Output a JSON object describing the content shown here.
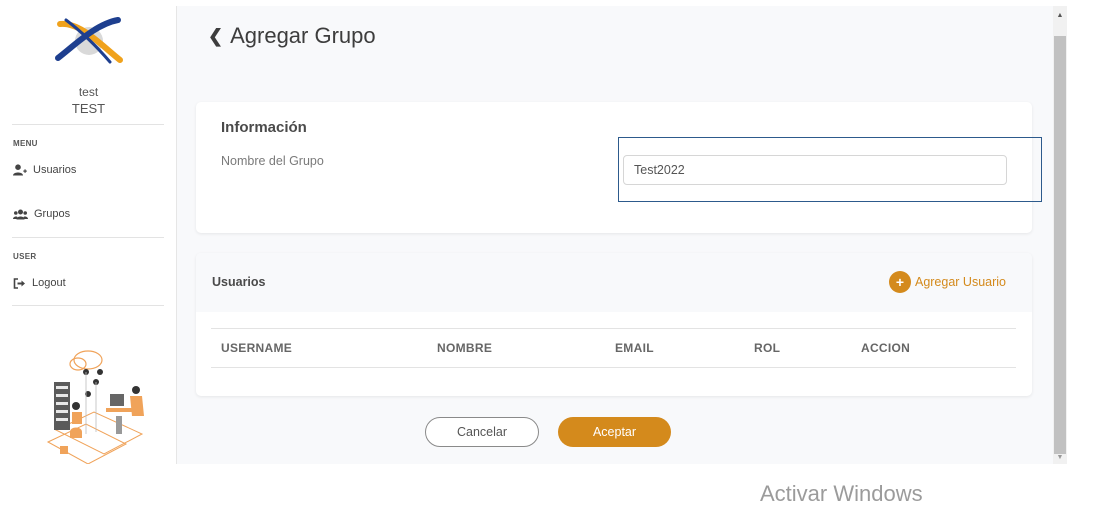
{
  "sidebar": {
    "user_name": "test",
    "user_role": "TEST",
    "menu_label": "MENU",
    "items": [
      {
        "label": "Usuarios",
        "icon": "user-plus-icon"
      },
      {
        "label": "Grupos",
        "icon": "users-group-icon"
      }
    ],
    "user_section_label": "USER",
    "logout_label": "Logout",
    "logout_icon": "sign-out-icon"
  },
  "page": {
    "title": "Agregar Grupo",
    "back_icon": "chevron-left-icon"
  },
  "info_card": {
    "title": "Información",
    "field_label": "Nombre del Grupo",
    "field_value": "Test2022"
  },
  "users_card": {
    "title": "Usuarios",
    "add_label": "Agregar Usuario",
    "columns": [
      "USERNAME",
      "NOMBRE",
      "EMAIL",
      "ROL",
      "ACCION"
    ]
  },
  "actions": {
    "cancel_label": "Cancelar",
    "accept_label": "Aceptar"
  },
  "watermark": "Activar Windows",
  "colors": {
    "accent": "#d48a1c",
    "focus_frame": "#2d5a8c",
    "logo_blue": "#1e3f8f",
    "logo_orange": "#f0a21c"
  }
}
